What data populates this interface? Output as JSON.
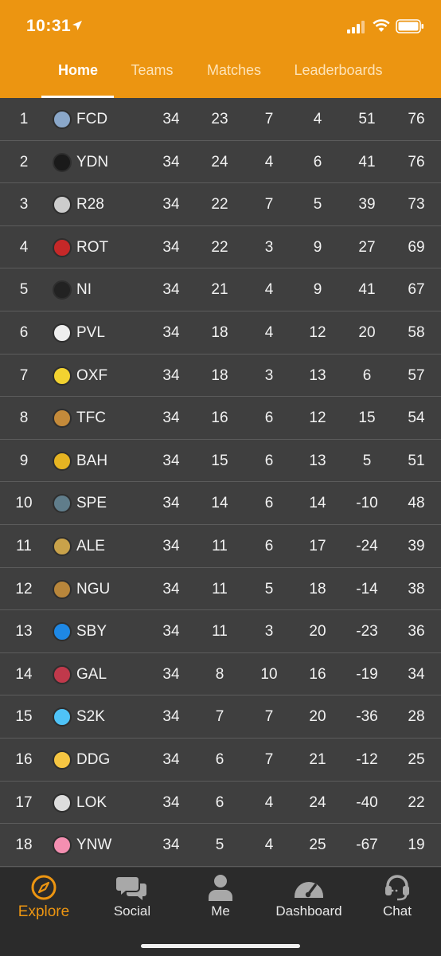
{
  "status": {
    "time": "10:31"
  },
  "tabs": [
    {
      "label": "Home",
      "active": true
    },
    {
      "label": "Teams",
      "active": false
    },
    {
      "label": "Matches",
      "active": false
    },
    {
      "label": "Leaderboards",
      "active": false
    }
  ],
  "standings": [
    {
      "pos": "1",
      "team": "FCD",
      "v1": "34",
      "v2": "23",
      "v3": "7",
      "v4": "4",
      "v5": "51",
      "v6": "76",
      "logo_color": "#8aa7c9"
    },
    {
      "pos": "2",
      "team": "YDN",
      "v1": "34",
      "v2": "24",
      "v3": "4",
      "v4": "6",
      "v5": "41",
      "v6": "76",
      "logo_color": "#1a1a1a"
    },
    {
      "pos": "3",
      "team": "R28",
      "v1": "34",
      "v2": "22",
      "v3": "7",
      "v4": "5",
      "v5": "39",
      "v6": "73",
      "logo_color": "#cccccc"
    },
    {
      "pos": "4",
      "team": "ROT",
      "v1": "34",
      "v2": "22",
      "v3": "3",
      "v4": "9",
      "v5": "27",
      "v6": "69",
      "logo_color": "#c62828"
    },
    {
      "pos": "5",
      "team": "NI",
      "v1": "34",
      "v2": "21",
      "v3": "4",
      "v4": "9",
      "v5": "41",
      "v6": "67",
      "logo_color": "#222222"
    },
    {
      "pos": "6",
      "team": "PVL",
      "v1": "34",
      "v2": "18",
      "v3": "4",
      "v4": "12",
      "v5": "20",
      "v6": "58",
      "logo_color": "#eeeeee"
    },
    {
      "pos": "7",
      "team": "OXF",
      "v1": "34",
      "v2": "18",
      "v3": "3",
      "v4": "13",
      "v5": "6",
      "v6": "57",
      "logo_color": "#f2d230"
    },
    {
      "pos": "8",
      "team": "TFC",
      "v1": "34",
      "v2": "16",
      "v3": "6",
      "v4": "12",
      "v5": "15",
      "v6": "54",
      "logo_color": "#c48a3a"
    },
    {
      "pos": "9",
      "team": "BAH",
      "v1": "34",
      "v2": "15",
      "v3": "6",
      "v4": "13",
      "v5": "5",
      "v6": "51",
      "logo_color": "#e6b422"
    },
    {
      "pos": "10",
      "team": "SPE",
      "v1": "34",
      "v2": "14",
      "v3": "6",
      "v4": "14",
      "v5": "-10",
      "v6": "48",
      "logo_color": "#607d8b"
    },
    {
      "pos": "11",
      "team": "ALE",
      "v1": "34",
      "v2": "11",
      "v3": "6",
      "v4": "17",
      "v5": "-24",
      "v6": "39",
      "logo_color": "#c9a24a"
    },
    {
      "pos": "12",
      "team": "NGU",
      "v1": "34",
      "v2": "11",
      "v3": "5",
      "v4": "18",
      "v5": "-14",
      "v6": "38",
      "logo_color": "#b8863b"
    },
    {
      "pos": "13",
      "team": "SBY",
      "v1": "34",
      "v2": "11",
      "v3": "3",
      "v4": "20",
      "v5": "-23",
      "v6": "36",
      "logo_color": "#1e88e5"
    },
    {
      "pos": "14",
      "team": "GAL",
      "v1": "34",
      "v2": "8",
      "v3": "10",
      "v4": "16",
      "v5": "-19",
      "v6": "34",
      "logo_color": "#c0394b"
    },
    {
      "pos": "15",
      "team": "S2K",
      "v1": "34",
      "v2": "7",
      "v3": "7",
      "v4": "20",
      "v5": "-36",
      "v6": "28",
      "logo_color": "#4fc3f7"
    },
    {
      "pos": "16",
      "team": "DDG",
      "v1": "34",
      "v2": "6",
      "v3": "7",
      "v4": "21",
      "v5": "-12",
      "v6": "25",
      "logo_color": "#f5c542"
    },
    {
      "pos": "17",
      "team": "LOK",
      "v1": "34",
      "v2": "6",
      "v3": "4",
      "v4": "24",
      "v5": "-40",
      "v6": "22",
      "logo_color": "#dddddd"
    },
    {
      "pos": "18",
      "team": "YNW",
      "v1": "34",
      "v2": "5",
      "v3": "4",
      "v4": "25",
      "v5": "-67",
      "v6": "19",
      "logo_color": "#f48fb1"
    }
  ],
  "nav": [
    {
      "label": "Explore",
      "icon": "compass-icon",
      "active": true
    },
    {
      "label": "Social",
      "icon": "chat-bubbles-icon",
      "active": false
    },
    {
      "label": "Me",
      "icon": "person-icon",
      "active": false
    },
    {
      "label": "Dashboard",
      "icon": "gauge-icon",
      "active": false
    },
    {
      "label": "Chat",
      "icon": "headset-icon",
      "active": false
    }
  ],
  "colors": {
    "accent": "#ec9511",
    "row_bg": "#3f3f3f",
    "tabbar_bg": "#2b2b2b"
  }
}
